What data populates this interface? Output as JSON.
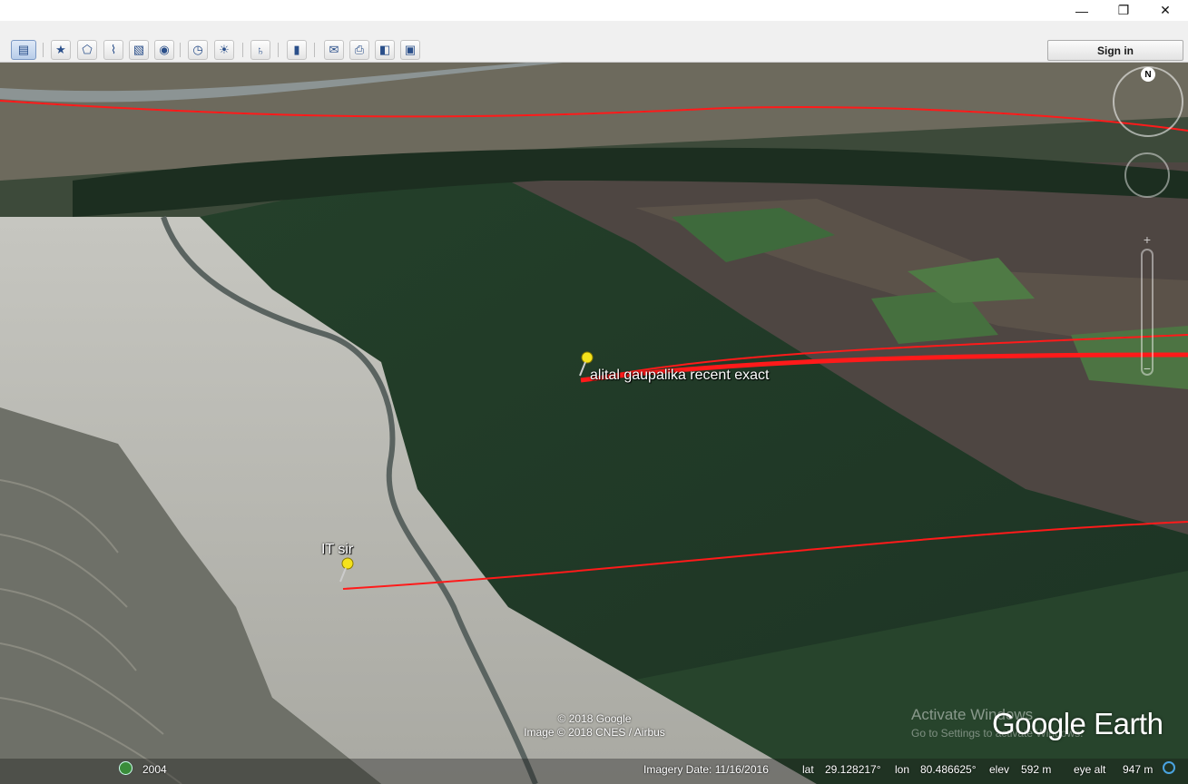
{
  "window": {
    "minimize_glyph": "—",
    "maximize_glyph": "❐",
    "close_glyph": "✕"
  },
  "toolbar": {
    "sign_in_label": "Sign in",
    "tools": [
      {
        "name": "sidebar-toggle-button",
        "icon": "sidebar-icon",
        "glyph": "▤"
      },
      {
        "name": "add-placemark-button",
        "icon": "pushpin-add-icon",
        "glyph": "★"
      },
      {
        "name": "add-polygon-button",
        "icon": "polygon-add-icon",
        "glyph": "⬠"
      },
      {
        "name": "add-path-button",
        "icon": "path-add-icon",
        "glyph": "⌇"
      },
      {
        "name": "add-image-overlay-button",
        "icon": "image-overlay-icon",
        "glyph": "▧"
      },
      {
        "name": "record-tour-button",
        "icon": "record-tour-icon",
        "glyph": "◉"
      },
      {
        "name": "historical-imagery-button",
        "icon": "clock-icon",
        "glyph": "◷"
      },
      {
        "name": "sunlight-button",
        "icon": "sun-icon",
        "glyph": "☀"
      },
      {
        "name": "planets-button",
        "icon": "planet-icon",
        "glyph": "♄"
      },
      {
        "name": "ruler-button",
        "icon": "ruler-icon",
        "glyph": "▮"
      },
      {
        "name": "email-button",
        "icon": "email-icon",
        "glyph": "✉"
      },
      {
        "name": "print-button",
        "icon": "print-icon",
        "glyph": "⎙"
      },
      {
        "name": "view-in-maps-button",
        "icon": "maps-icon",
        "glyph": "◧"
      },
      {
        "name": "save-image-button",
        "icon": "save-image-icon",
        "glyph": "▣"
      }
    ]
  },
  "map": {
    "placemarks": [
      {
        "label": "alital gaupalika recent exact"
      },
      {
        "label": "IT sir"
      }
    ],
    "compass_n": "N",
    "zoom_plus": "+",
    "zoom_minus": "−",
    "copyright_line1": "© 2018 Google",
    "copyright_line2": "Image © 2018 CNES / Airbus",
    "watermark_line1": "Activate Windows",
    "watermark_line2": "Go to Settings to activate Windows.",
    "logo_text": "Google Earth",
    "path_color": "#ff1a1a",
    "pin_color": "#f4e21c"
  },
  "status": {
    "history_year": "2004",
    "imagery_date_label": "Imagery Date: 11/16/2016",
    "lat_label": "lat",
    "lat_value": "29.128217°",
    "lon_label": "lon",
    "lon_value": "80.486625°",
    "elev_label": "elev",
    "elev_value": "592 m",
    "eye_alt_label": "eye alt",
    "eye_alt_value": "947 m"
  }
}
